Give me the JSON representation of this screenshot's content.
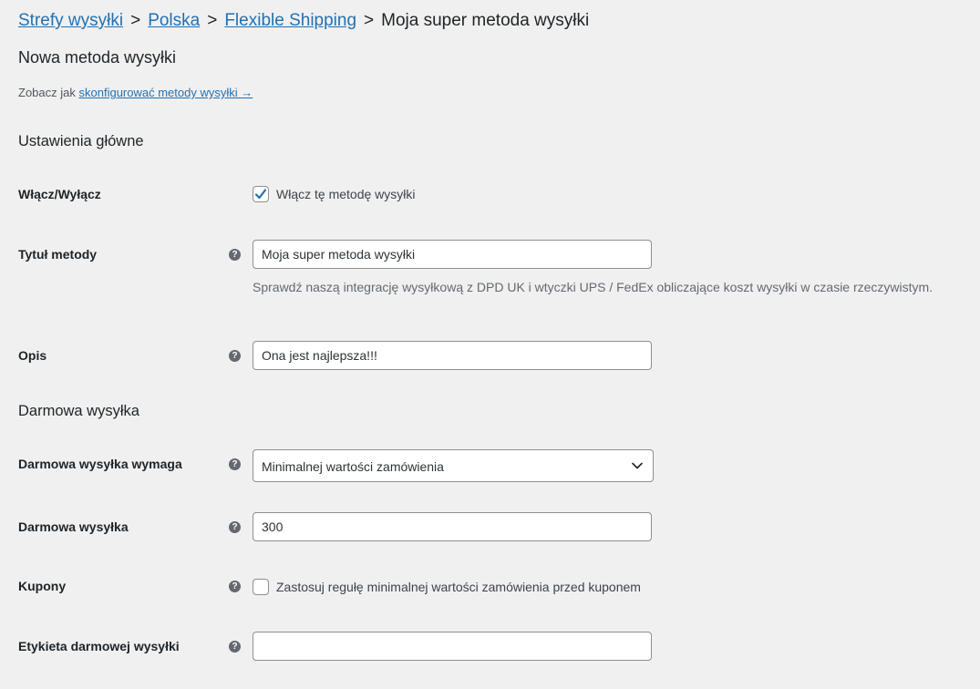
{
  "breadcrumb": {
    "items": [
      {
        "label": "Strefy wysyłki"
      },
      {
        "label": "Polska"
      },
      {
        "label": "Flexible Shipping"
      }
    ],
    "separator": ">",
    "current": "Moja super metoda wysyłki"
  },
  "page_title": "Nowa metoda wysyłki",
  "info": {
    "prefix": "Zobacz jak",
    "link_label": "skonfigurować metody wysyłki →"
  },
  "sections": {
    "main_settings": "Ustawienia główne",
    "free_shipping": "Darmowa wysyłka"
  },
  "fields": {
    "enable": {
      "label": "Włącz/Wyłącz",
      "checkbox_label": "Włącz tę metodę wysyłki",
      "checked": true
    },
    "title": {
      "label": "Tytuł metody",
      "value": "Moja super metoda wysyłki",
      "description": "Sprawdź naszą integrację wysyłkową z DPD UK i wtyczki UPS / FedEx obliczające koszt wysyłki w czasie rzeczywistym."
    },
    "description": {
      "label": "Opis",
      "value": "Ona jest najlepsza!!!"
    },
    "free_requires": {
      "label": "Darmowa wysyłka wymaga",
      "selected": "Minimalnej wartości zamówienia"
    },
    "free_amount": {
      "label": "Darmowa wysyłka",
      "value": "300"
    },
    "coupons": {
      "label": "Kupony",
      "checkbox_label": "Zastosuj regułę minimalnej wartości zamówienia przed kuponem",
      "checked": false
    },
    "free_label": {
      "label": "Etykieta darmowej wysyłki",
      "value": ""
    }
  },
  "help_icon_glyph": "?",
  "colors": {
    "link": "#2271b1",
    "background": "#f0f0f1",
    "checkbox_check": "#2271b1"
  }
}
